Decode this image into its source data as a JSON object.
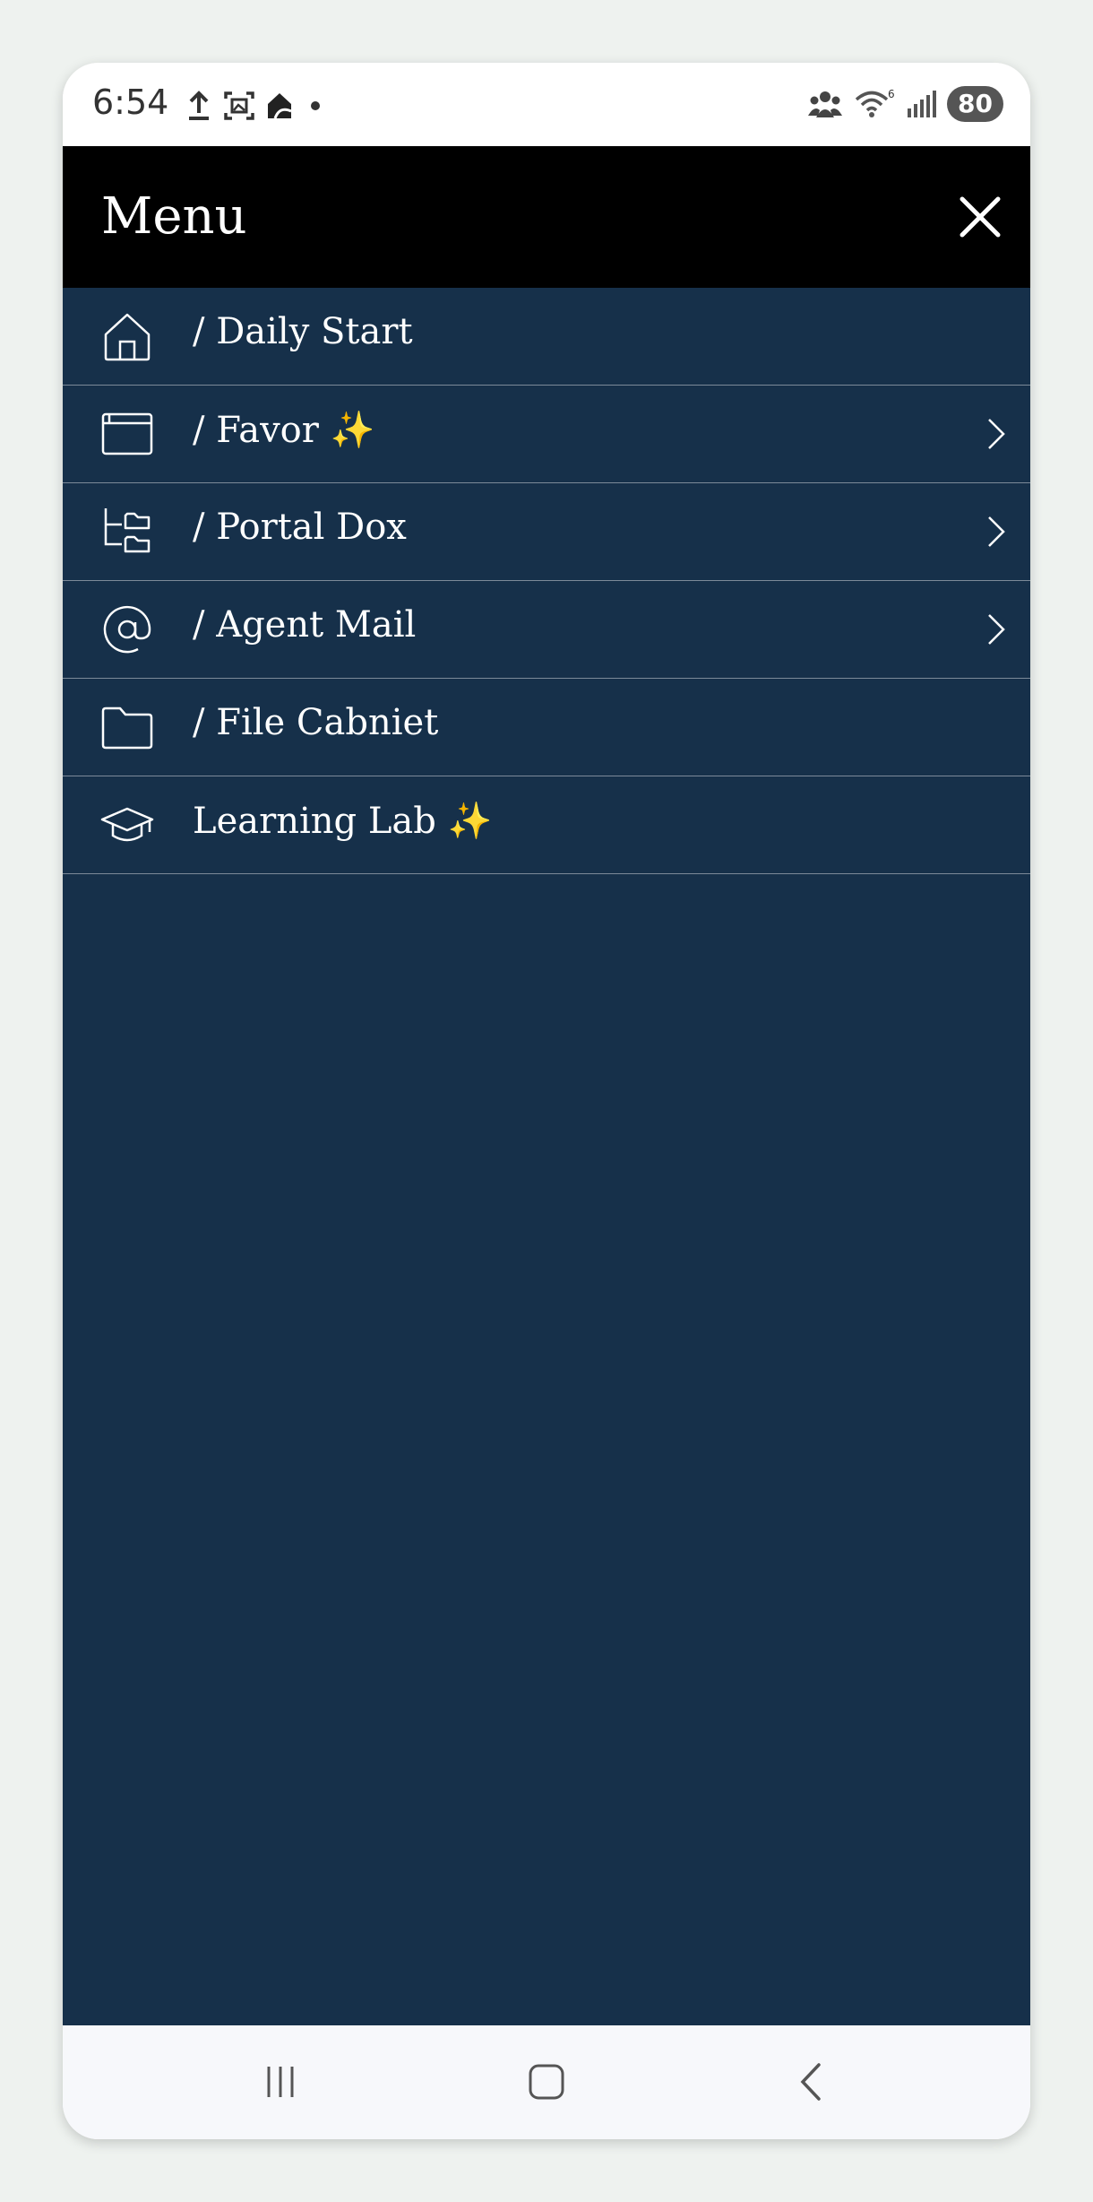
{
  "status_bar": {
    "time": "6:54",
    "battery": "80",
    "icons": [
      "upload-icon",
      "screenshot-icon",
      "home-app-icon",
      "dot-icon",
      "people-icon",
      "wifi-icon",
      "signal-icon"
    ]
  },
  "menu": {
    "title": "Menu",
    "items": [
      {
        "label": "/ Daily Start",
        "icon": "home-icon",
        "has_submenu": false
      },
      {
        "label": "/ Favor ✨",
        "icon": "browser-window-icon",
        "has_submenu": true
      },
      {
        "label": "/ Portal Dox",
        "icon": "folder-tree-icon",
        "has_submenu": true
      },
      {
        "label": "/ Agent Mail",
        "icon": "at-sign-icon",
        "has_submenu": true
      },
      {
        "label": "/ File Cabniet",
        "icon": "folder-icon",
        "has_submenu": false
      },
      {
        "label": "Learning Lab ✨",
        "icon": "graduation-cap-icon",
        "has_submenu": false
      }
    ]
  },
  "colors": {
    "header_bg": "#000000",
    "menu_bg": "#16304a",
    "divider": "#7c8a99",
    "text": "#ffffff"
  }
}
